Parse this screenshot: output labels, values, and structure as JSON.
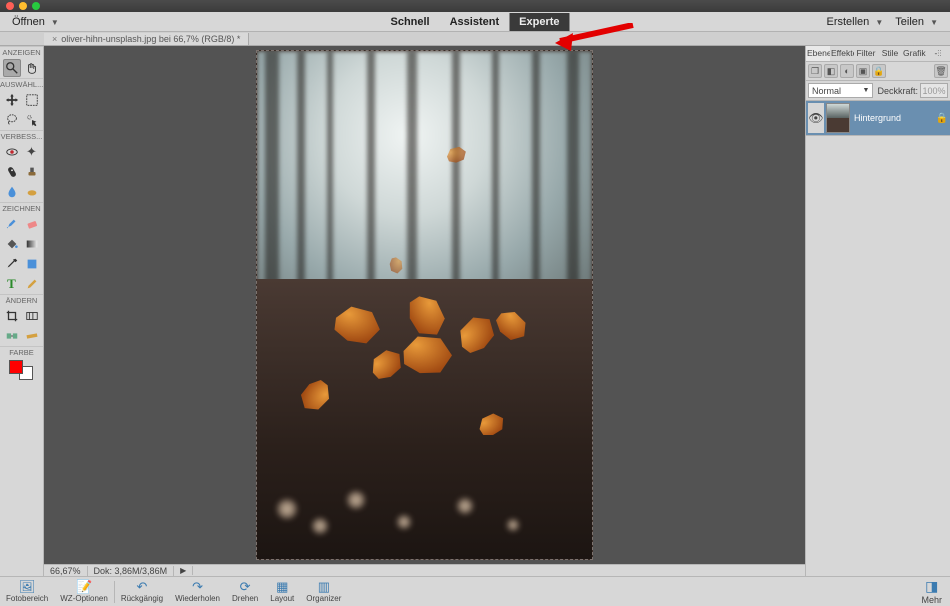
{
  "menu": {
    "open": "Öffnen"
  },
  "tabs": {
    "schnell": "Schnell",
    "assistent": "Assistent",
    "experte": "Experte"
  },
  "top_right": {
    "erstellen": "Erstellen",
    "teilen": "Teilen"
  },
  "doc_tab": "oliver-hihn-unsplash.jpg bei 66,7% (RGB/8) *",
  "tool_sections": {
    "anzeigen": "ANZEIGEN",
    "auswahl": "AUSWÄHL...",
    "verbessern": "VERBESS...",
    "zeichnen": "ZEICHNEN",
    "aendern": "ÄNDERN",
    "farbe": "FARBE"
  },
  "colors": {
    "fg": "#ff0000",
    "bg": "#ffffff"
  },
  "status": {
    "zoom": "66,67%",
    "dok": "Dok: 3,86M/3,86M"
  },
  "right_panel": {
    "tabs": {
      "ebenen": "Ebenen",
      "effekte": "Effekte",
      "filter": "Filter",
      "stile": "Stile",
      "grafike": "Grafike",
      "more": "-⫶⫶"
    },
    "blend_mode": "Normal",
    "opacity_label": "Deckkraft:",
    "opacity_value": "100%",
    "layer_name": "Hintergrund"
  },
  "bottom": {
    "fotobereich": "Fotobereich",
    "wz": "WZ-Optionen",
    "undo": "Rückgängig",
    "redo": "Wiederholen",
    "rotate": "Drehen",
    "layout": "Layout",
    "organizer": "Organizer",
    "mehr": "Mehr"
  }
}
